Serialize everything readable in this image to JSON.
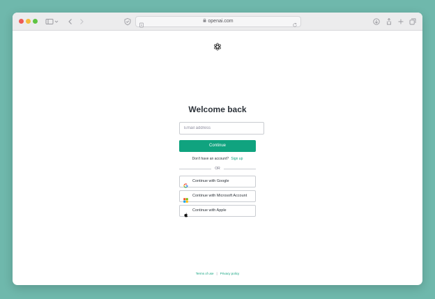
{
  "browser": {
    "url": "openai.com"
  },
  "login": {
    "title": "Welcome back",
    "email_placeholder": "Email address",
    "continue_label": "Continue",
    "no_account_text": "Don't have an account?",
    "signup_label": "Sign up",
    "or_label": "OR",
    "google_label": "Continue with Google",
    "microsoft_label": "Continue with Microsoft Account",
    "apple_label": "Continue with Apple"
  },
  "footer": {
    "terms_label": "Terms of use",
    "separator": "|",
    "privacy_label": "Privacy policy"
  },
  "colors": {
    "accent": "#10a37f",
    "background": "#6fb8ac"
  },
  "icons": {
    "logo": "openai-logo-icon",
    "google": "google-icon",
    "microsoft": "microsoft-icon",
    "apple": "apple-icon"
  }
}
